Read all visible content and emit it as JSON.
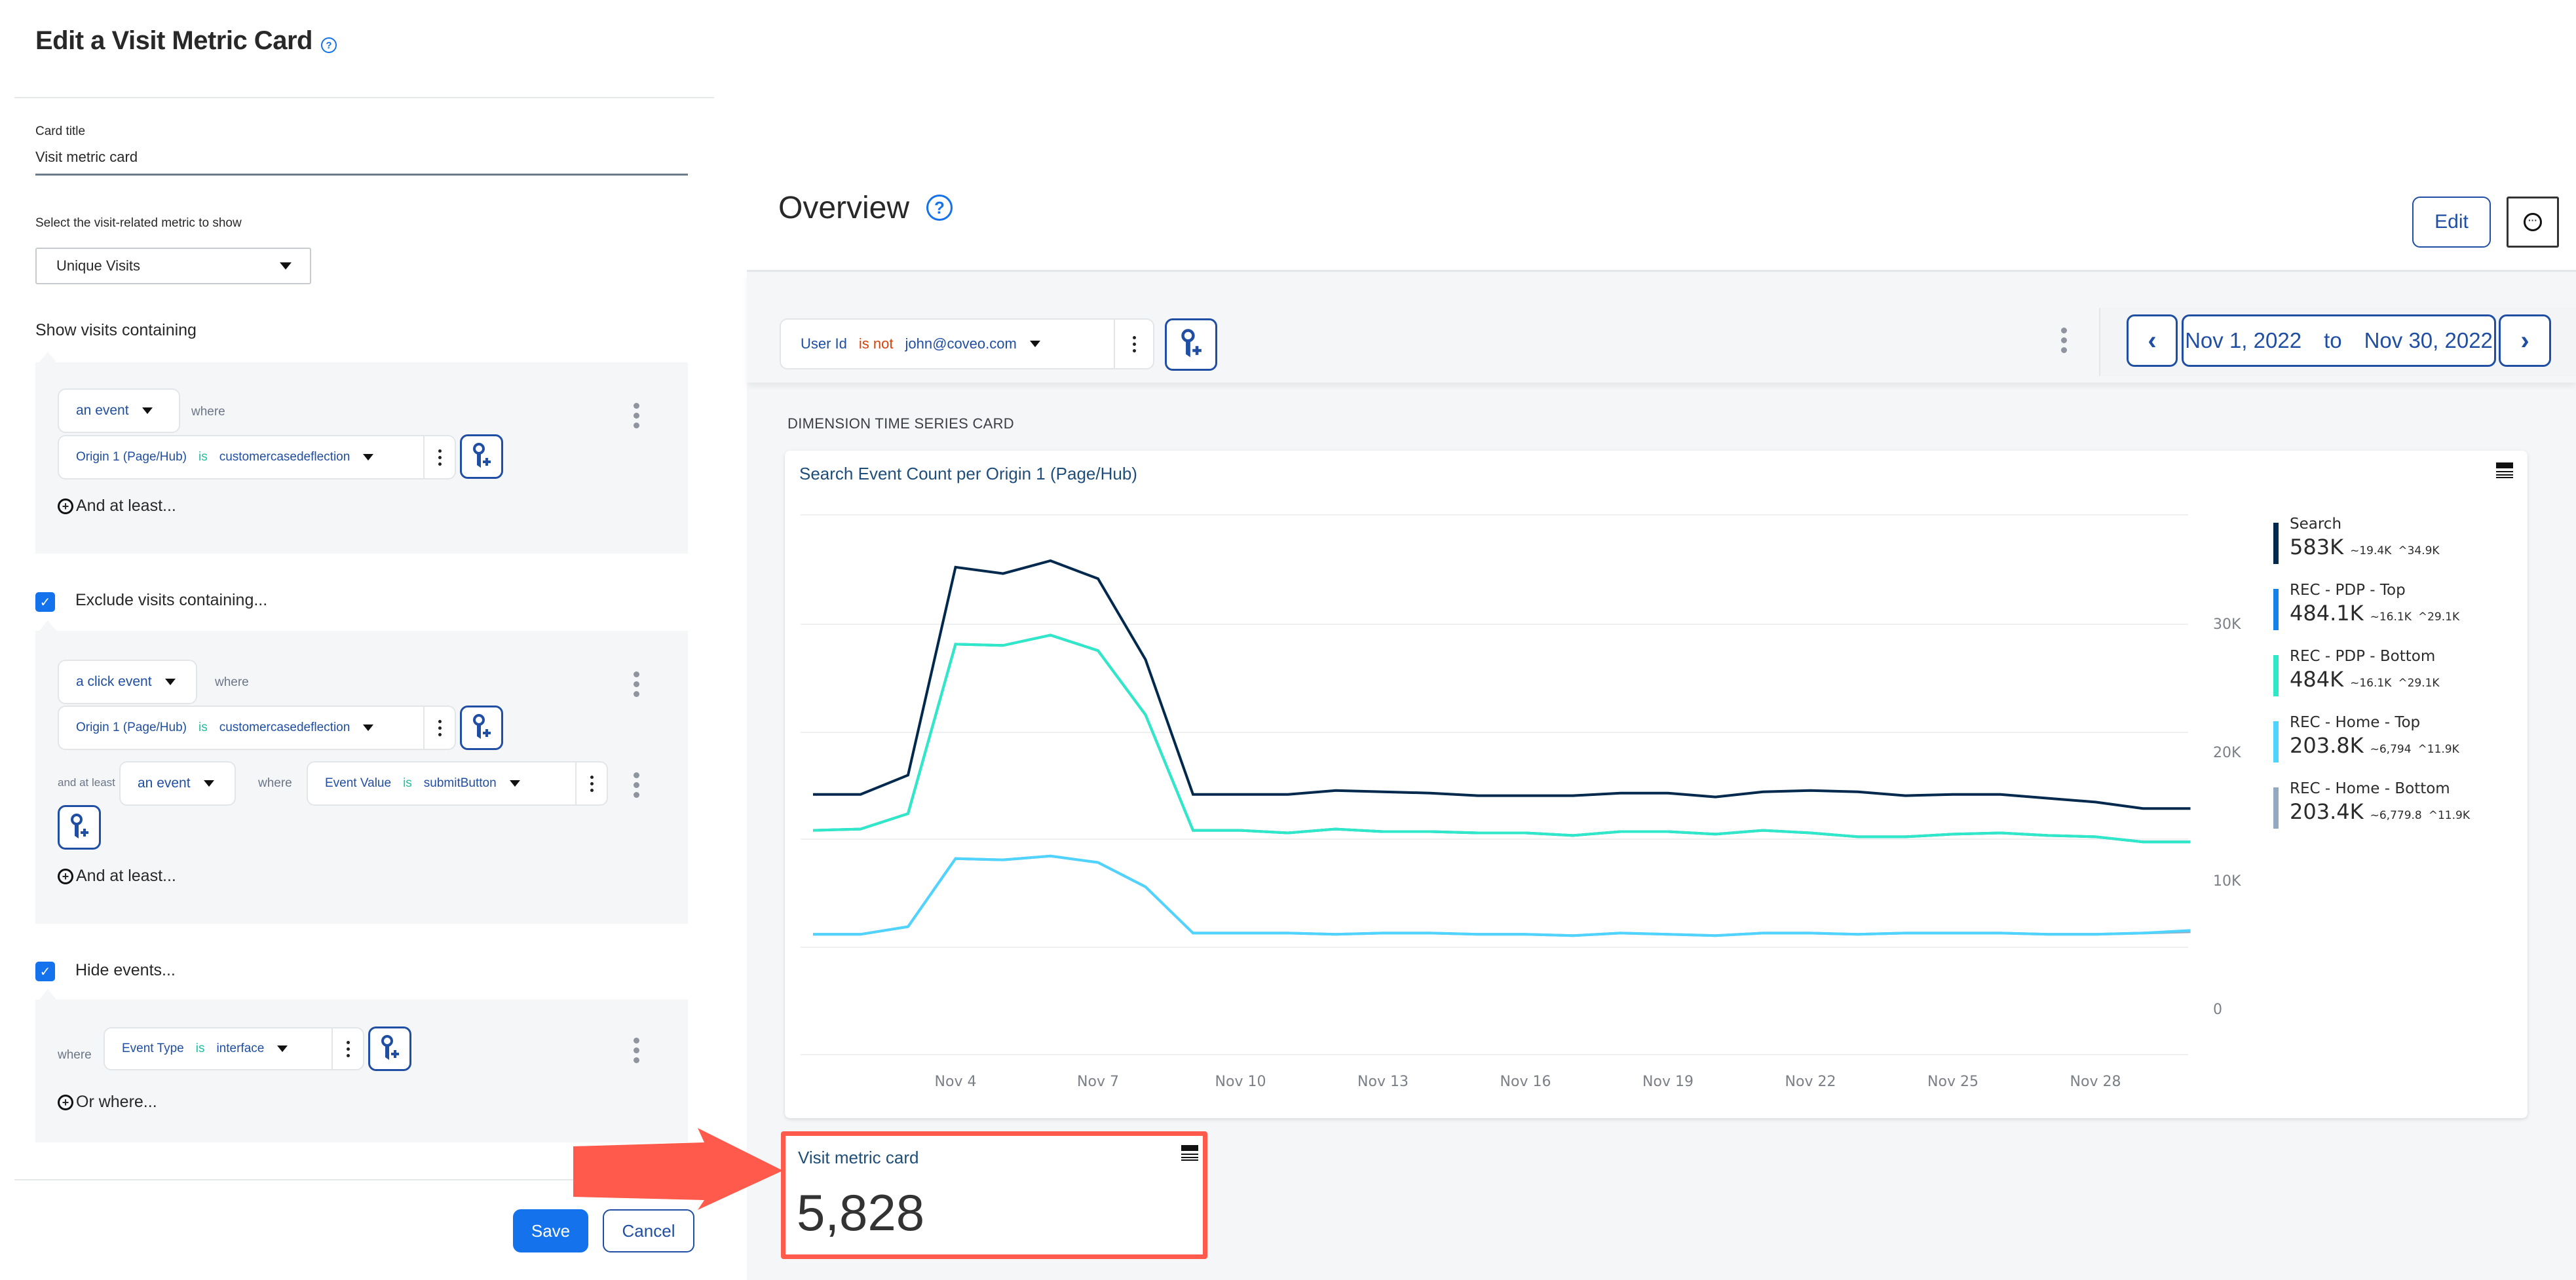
{
  "editor": {
    "title": "Edit a Visit Metric Card",
    "help_icon": "question-circle-icon",
    "card_title_label": "Card title",
    "card_title_value": "Visit metric card",
    "metric_select_label": "Select the visit-related metric to show",
    "metric_select_value": "Unique Visits",
    "show_visits_heading": "Show visits containing",
    "show_block": {
      "event_type": "an event",
      "where": "where",
      "filter": {
        "dimension": "Origin 1 (Page/Hub)",
        "operator": "is",
        "value": "customercasedeflection"
      },
      "add_link": "And at least..."
    },
    "exclude": {
      "checked": true,
      "label": "Exclude visits containing...",
      "event_type": "a click event",
      "where": "where",
      "filter": {
        "dimension": "Origin 1 (Page/Hub)",
        "operator": "is",
        "value": "customercasedeflection"
      },
      "and_at_least_label": "and at least",
      "second_event_type": "an event",
      "second_where": "where",
      "second_filter": {
        "dimension": "Event Value",
        "operator": "is",
        "value": "submitButton"
      },
      "add_link": "And at least..."
    },
    "hide": {
      "checked": true,
      "label": "Hide events...",
      "where": "where",
      "filter": {
        "dimension": "Event Type",
        "operator": "is",
        "value": "interface"
      },
      "add_link": "Or where..."
    },
    "save_label": "Save",
    "cancel_label": "Cancel"
  },
  "dashboard": {
    "title": "Overview",
    "edit_label": "Edit",
    "more_icon": "ellipsis-circle-icon",
    "global_filter": {
      "dimension": "User Id",
      "operator": "is not",
      "value": "john@coveo.com"
    },
    "date_from": "Nov 1, 2022",
    "date_to_word": "to",
    "date_to": "Nov 30, 2022",
    "section_caption": "DIMENSION TIME SERIES CARD",
    "chart_card_title": "Search Event Count per Origin 1 (Page/Hub)",
    "legend": [
      {
        "name": "Search",
        "total": "583K",
        "avg": "19.4K",
        "peak": "34.9K",
        "color": "#00294d"
      },
      {
        "name": "REC - PDP - Top",
        "total": "484.1K",
        "avg": "16.1K",
        "peak": "29.1K",
        "color": "#1582ec"
      },
      {
        "name": "REC - PDP - Bottom",
        "total": "484K",
        "avg": "16.1K",
        "peak": "29.1K",
        "color": "#2ee8c8"
      },
      {
        "name": "REC - Home - Top",
        "total": "203.8K",
        "avg": "6,794",
        "peak": "11.9K",
        "color": "#4fd3ff"
      },
      {
        "name": "REC - Home - Bottom",
        "total": "203.4K",
        "avg": "6,779.8",
        "peak": "11.9K",
        "color": "#93a9c2"
      }
    ],
    "metric_card": {
      "title": "Visit metric card",
      "value": "5,828"
    }
  },
  "chart_data": {
    "type": "line",
    "title": "Search Event Count per Origin 1 (Page/Hub)",
    "xlabel": "",
    "ylabel": "",
    "x": [
      "Nov 1",
      "Nov 2",
      "Nov 3",
      "Nov 4",
      "Nov 5",
      "Nov 6",
      "Nov 7",
      "Nov 8",
      "Nov 9",
      "Nov 10",
      "Nov 11",
      "Nov 12",
      "Nov 13",
      "Nov 14",
      "Nov 15",
      "Nov 16",
      "Nov 17",
      "Nov 18",
      "Nov 19",
      "Nov 20",
      "Nov 21",
      "Nov 22",
      "Nov 23",
      "Nov 24",
      "Nov 25",
      "Nov 26",
      "Nov 27",
      "Nov 28",
      "Nov 29",
      "Nov 30"
    ],
    "x_tick_labels": [
      "Nov 4",
      "Nov 7",
      "Nov 10",
      "Nov 13",
      "Nov 16",
      "Nov 19",
      "Nov 22",
      "Nov 25",
      "Nov 28"
    ],
    "y_tick_labels": [
      "0",
      "10K",
      "20K",
      "30K"
    ],
    "y_ticks": [
      0,
      10000,
      20000,
      30000
    ],
    "ylim": [
      0,
      36000
    ],
    "grid": true,
    "legend_position": "right",
    "series": [
      {
        "name": "Search",
        "color": "#00294d",
        "values": [
          16700,
          16700,
          18200,
          34400,
          33900,
          34900,
          33500,
          27200,
          16700,
          16700,
          16700,
          17000,
          16900,
          16800,
          16600,
          16600,
          16600,
          16800,
          16800,
          16500,
          16900,
          17000,
          16900,
          16600,
          16700,
          16700,
          16400,
          16100,
          15600,
          15600
        ]
      },
      {
        "name": "REC - PDP - Top",
        "color": "#1582ec",
        "values": [
          13900,
          14000,
          15200,
          28400,
          28300,
          29100,
          27900,
          22900,
          13900,
          13900,
          13700,
          14000,
          13800,
          13800,
          13700,
          13700,
          13500,
          13800,
          13800,
          13600,
          13900,
          13700,
          13400,
          13400,
          13600,
          13700,
          13500,
          13400,
          13000,
          13000
        ]
      },
      {
        "name": "REC - PDP - Bottom",
        "color": "#2ee8c8",
        "values": [
          13900,
          14000,
          15200,
          28400,
          28300,
          29100,
          27900,
          22900,
          13900,
          13900,
          13700,
          14000,
          13800,
          13800,
          13700,
          13700,
          13500,
          13800,
          13800,
          13600,
          13900,
          13700,
          13400,
          13400,
          13600,
          13700,
          13500,
          13400,
          13000,
          13000
        ]
      },
      {
        "name": "REC - Home - Top",
        "color": "#4fd3ff",
        "values": [
          5800,
          5800,
          6400,
          11700,
          11600,
          11900,
          11400,
          9500,
          5900,
          5900,
          5900,
          5800,
          5900,
          5900,
          5800,
          5800,
          5700,
          5900,
          5800,
          5700,
          5900,
          5900,
          5800,
          5900,
          5900,
          5900,
          5800,
          5800,
          5900,
          6100
        ]
      },
      {
        "name": "REC - Home - Bottom",
        "color": "#93a9c2",
        "values": [
          5800,
          5800,
          6400,
          11700,
          11600,
          11900,
          11400,
          9500,
          5900,
          5900,
          5900,
          5800,
          5900,
          5900,
          5800,
          5800,
          5700,
          5900,
          5800,
          5700,
          5900,
          5900,
          5800,
          5900,
          5900,
          5900,
          5800,
          5800,
          5900,
          6000
        ]
      }
    ]
  }
}
